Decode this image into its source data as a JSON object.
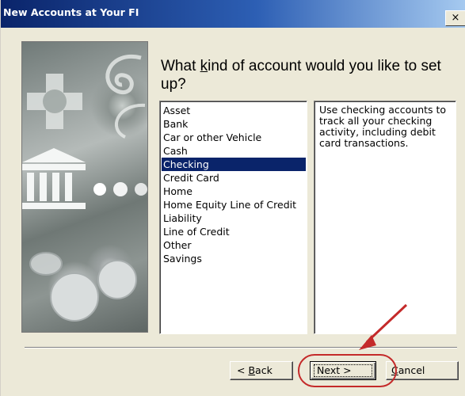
{
  "window": {
    "title": "New Accounts at Your FI",
    "close_label": "×"
  },
  "question": {
    "before": "What ",
    "accel": "k",
    "after": "ind of account would you like to set up?"
  },
  "account_types": [
    "Asset",
    "Bank",
    "Car or other Vehicle",
    "Cash",
    "Checking",
    "Credit Card",
    "Home",
    "Home Equity Line of Credit",
    "Liability",
    "Line of Credit",
    "Other",
    "Savings"
  ],
  "selected_account": "Checking",
  "description": "Use checking accounts to track all your checking activity, including debit card transactions.",
  "buttons": {
    "back_accel": "B",
    "back_rest": "ack",
    "back_prefix": "< ",
    "next_label": "Next >",
    "cancel_accel": "C",
    "cancel_rest": "ancel"
  },
  "colors": {
    "selection": "#0a246a",
    "annotation": "#c42a2a"
  }
}
